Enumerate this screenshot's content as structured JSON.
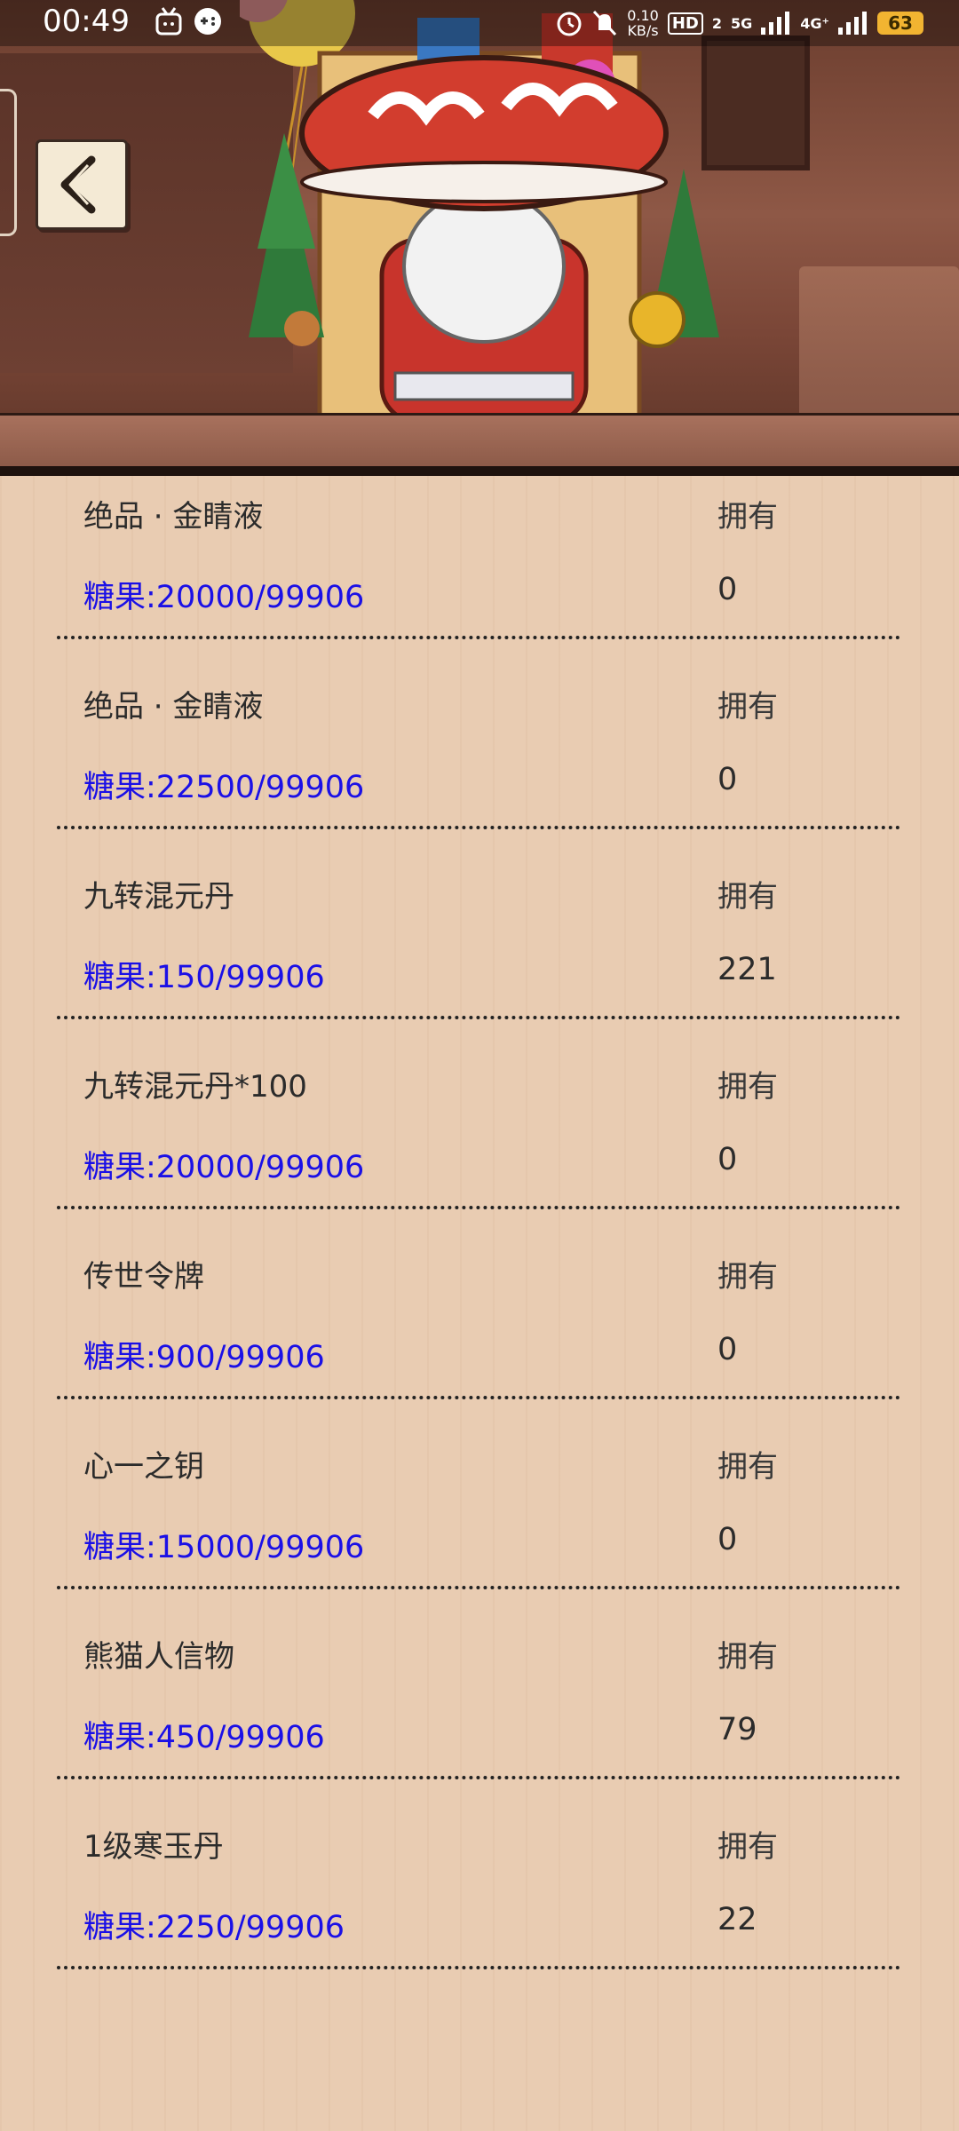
{
  "status_bar": {
    "time": "00:49",
    "net_speed_value": "0.10",
    "net_speed_unit": "KB/s",
    "hd_label": "HD",
    "sim_slot": "2",
    "net_5g": "5G",
    "net_4g": "4G⁺",
    "battery": "63"
  },
  "back_button": {
    "icon": "chevron-left-icon"
  },
  "shop_items": [
    {
      "name": "绝品 · 金睛液",
      "price": "糖果:20000/99906",
      "owned_label": "拥有",
      "owned": "0"
    },
    {
      "name": "绝品 · 金睛液",
      "price": "糖果:22500/99906",
      "owned_label": "拥有",
      "owned": "0"
    },
    {
      "name": "九转混元丹",
      "price": "糖果:150/99906",
      "owned_label": "拥有",
      "owned": "221"
    },
    {
      "name": "九转混元丹*100",
      "price": "糖果:20000/99906",
      "owned_label": "拥有",
      "owned": "0"
    },
    {
      "name": "传世令牌",
      "price": "糖果:900/99906",
      "owned_label": "拥有",
      "owned": "0"
    },
    {
      "name": "心一之钥",
      "price": "糖果:15000/99906",
      "owned_label": "拥有",
      "owned": "0"
    },
    {
      "name": "熊猫人信物",
      "price": "糖果:450/99906",
      "owned_label": "拥有",
      "owned": "79"
    },
    {
      "name": "1级寒玉丹",
      "price": "糖果:2250/99906",
      "owned_label": "拥有",
      "owned": "22"
    }
  ],
  "colors": {
    "price_text": "#1b10e6",
    "background": "#e9ccb2",
    "battery": "#f2b431"
  }
}
